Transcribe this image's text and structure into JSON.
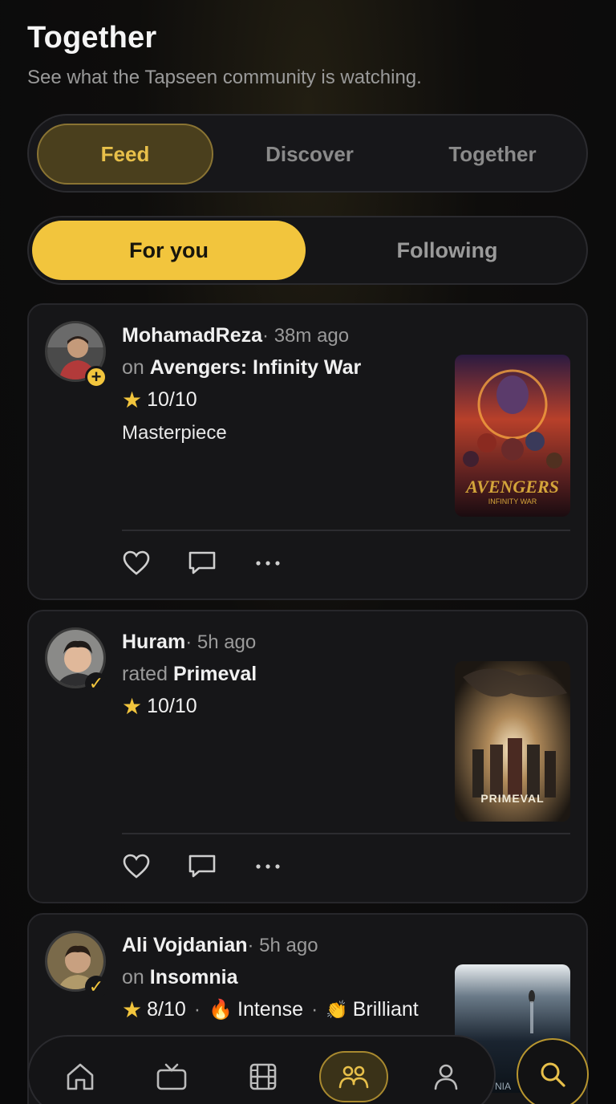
{
  "header": {
    "title": "Together",
    "subtitle": "See what the Tapseen community is watching."
  },
  "main_tabs": [
    {
      "label": "Feed",
      "active": true
    },
    {
      "label": "Discover",
      "active": false
    },
    {
      "label": "Together",
      "active": false
    }
  ],
  "sub_tabs": [
    {
      "label": "For you",
      "active": true
    },
    {
      "label": "Following",
      "active": false
    }
  ],
  "posts": [
    {
      "user": "MohamadReza",
      "time": "· 38m ago",
      "verb": "on",
      "title": "Avengers: Infinity War",
      "rating": "10/10",
      "comment": "Masterpiece",
      "badge": "plus-icon",
      "poster_text": "AVENGERS",
      "poster_subtext": "INFINITY WAR"
    },
    {
      "user": "Huram",
      "time": "· 5h ago",
      "verb": "rated",
      "title": "Primeval",
      "rating": "10/10",
      "badge": "check-icon",
      "poster_text": "PRIMEVAL"
    },
    {
      "user": "Ali Vojdanian",
      "time": "· 5h ago",
      "verb": "on",
      "title": "Insomnia",
      "rating": "8/10",
      "tag1": "Intense",
      "tag2": "Brilliant",
      "badge": "check-icon",
      "poster_text": "NIA"
    }
  ],
  "colors": {
    "accent": "#f2c53d",
    "background": "#0b0b0d",
    "card": "#161618"
  },
  "nav": [
    "home-icon",
    "tv-icon",
    "film-icon",
    "community-icon",
    "profile-icon"
  ],
  "search_icon": "search-icon"
}
